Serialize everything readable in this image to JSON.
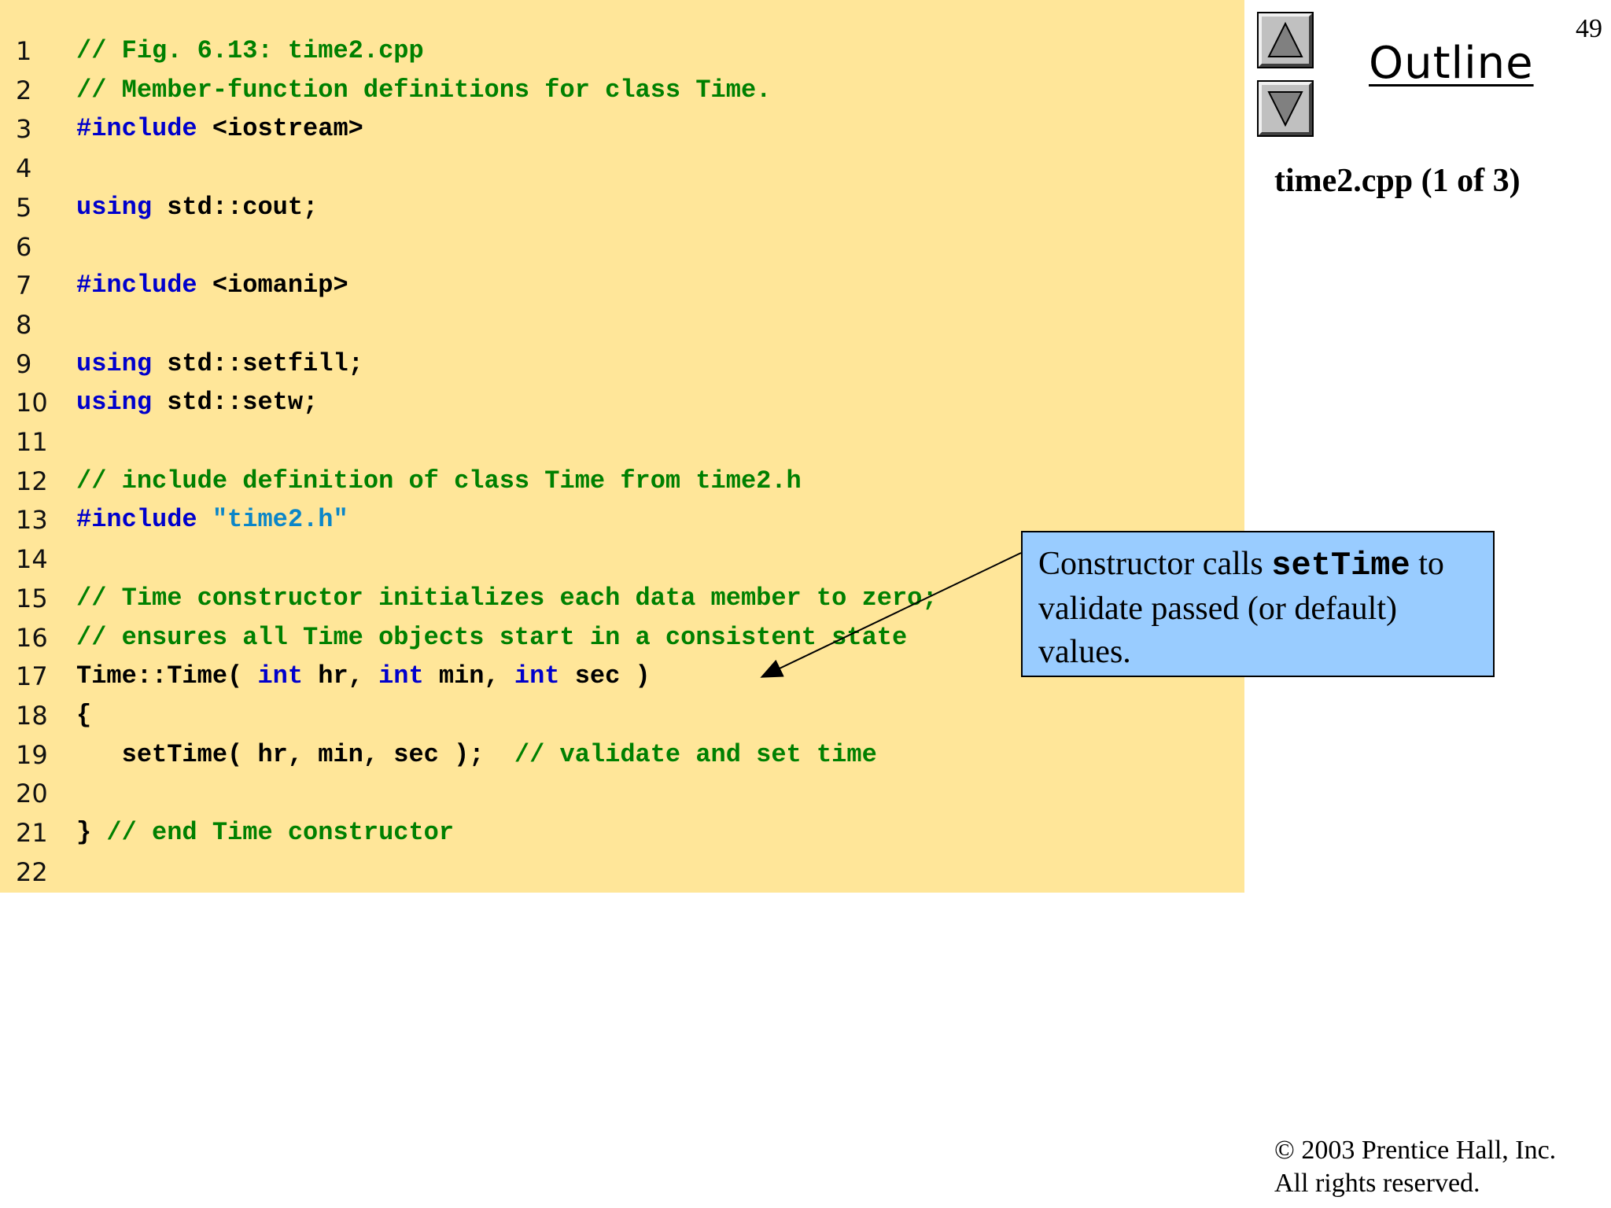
{
  "slide": {
    "page_number": "49",
    "outline_label": "Outline",
    "file_caption": "time2.cpp (1 of 3)",
    "copyright_line1": "© 2003 Prentice Hall, Inc.",
    "copyright_line2": "All rights reserved.",
    "nav": {
      "up_icon": "up-triangle-icon",
      "down_icon": "down-triangle-icon"
    }
  },
  "colors": {
    "code_background": "#ffe699",
    "callout_background": "#99ccff",
    "comment": "#008000",
    "keyword": "#0000cc",
    "string": "#0b86c8"
  },
  "callout": {
    "text_before": "Constructor calls ",
    "code_term": "setTime",
    "text_after": " to validate passed (or default) values."
  },
  "code_lines": [
    {
      "num": "1",
      "tokens": [
        {
          "t": "comment",
          "v": "// Fig. 6.13: time2.cpp"
        }
      ]
    },
    {
      "num": "2",
      "tokens": [
        {
          "t": "comment",
          "v": "// Member-function definitions for class Time."
        }
      ]
    },
    {
      "num": "3",
      "tokens": [
        {
          "t": "keyword",
          "v": "#include"
        },
        {
          "t": "plain",
          "v": " <iostream>"
        }
      ]
    },
    {
      "num": "4",
      "tokens": []
    },
    {
      "num": "5",
      "tokens": [
        {
          "t": "keyword",
          "v": "using"
        },
        {
          "t": "plain",
          "v": " std::cout;"
        }
      ]
    },
    {
      "num": "6",
      "tokens": []
    },
    {
      "num": "7",
      "tokens": [
        {
          "t": "keyword",
          "v": "#include"
        },
        {
          "t": "plain",
          "v": " <iomanip>"
        }
      ]
    },
    {
      "num": "8",
      "tokens": []
    },
    {
      "num": "9",
      "tokens": [
        {
          "t": "keyword",
          "v": "using"
        },
        {
          "t": "plain",
          "v": " std::setfill;"
        }
      ]
    },
    {
      "num": "10",
      "tokens": [
        {
          "t": "keyword",
          "v": "using"
        },
        {
          "t": "plain",
          "v": " std::setw;"
        }
      ]
    },
    {
      "num": "11",
      "tokens": []
    },
    {
      "num": "12",
      "tokens": [
        {
          "t": "comment",
          "v": "// include definition of class Time from time2.h"
        }
      ]
    },
    {
      "num": "13",
      "tokens": [
        {
          "t": "keyword",
          "v": "#include"
        },
        {
          "t": "plain",
          "v": " "
        },
        {
          "t": "string",
          "v": "\"time2.h\""
        }
      ]
    },
    {
      "num": "14",
      "tokens": []
    },
    {
      "num": "15",
      "tokens": [
        {
          "t": "comment",
          "v": "// Time constructor initializes each data member to zero;"
        }
      ]
    },
    {
      "num": "16",
      "tokens": [
        {
          "t": "comment",
          "v": "// ensures all Time objects start in a consistent state"
        }
      ]
    },
    {
      "num": "17",
      "tokens": [
        {
          "t": "plain",
          "v": "Time::Time( "
        },
        {
          "t": "keyword",
          "v": "int"
        },
        {
          "t": "plain",
          "v": " hr, "
        },
        {
          "t": "keyword",
          "v": "int"
        },
        {
          "t": "plain",
          "v": " min, "
        },
        {
          "t": "keyword",
          "v": "int"
        },
        {
          "t": "plain",
          "v": " sec )"
        }
      ]
    },
    {
      "num": "18",
      "tokens": [
        {
          "t": "plain",
          "v": "{"
        }
      ]
    },
    {
      "num": "19",
      "tokens": [
        {
          "t": "plain",
          "v": "   setTime( hr, min, sec );  "
        },
        {
          "t": "comment",
          "v": "// validate and set time"
        }
      ]
    },
    {
      "num": "20",
      "tokens": []
    },
    {
      "num": "21",
      "tokens": [
        {
          "t": "plain",
          "v": "} "
        },
        {
          "t": "comment",
          "v": "// end Time constructor"
        }
      ]
    },
    {
      "num": "22",
      "tokens": []
    }
  ]
}
